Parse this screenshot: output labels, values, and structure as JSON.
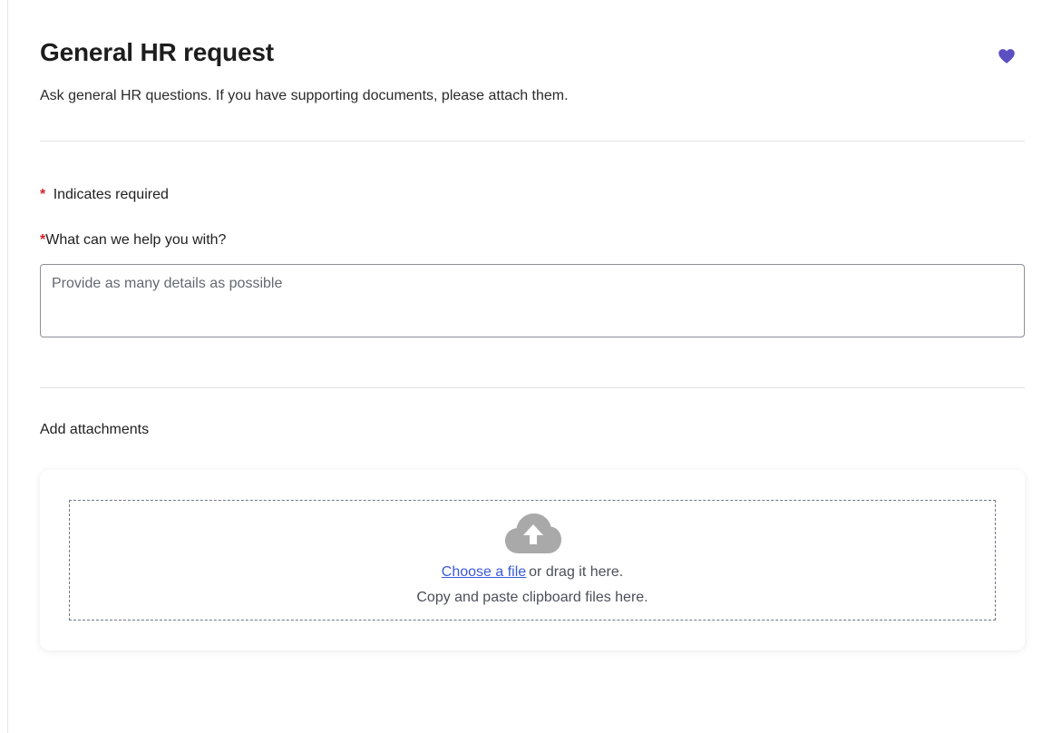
{
  "header": {
    "title": "General HR request",
    "description": "Ask general HR questions. If you have supporting documents, please attach them."
  },
  "form": {
    "required_marker": "*",
    "required_note": "Indicates required",
    "question_label": "What can we help you with?",
    "question_value": "",
    "question_placeholder": "Provide as many details as possible"
  },
  "attachments": {
    "label": "Add attachments",
    "choose_link": "Choose a file",
    "drag_text": "or drag it here.",
    "paste_text": "Copy and paste clipboard files here."
  },
  "icons": {
    "favorite": "heart-icon",
    "upload": "cloud-upload-icon"
  },
  "colors": {
    "accent": "#5b4fc2",
    "required": "#d1242f",
    "link": "#3a5bd9",
    "upload_icon": "#a9a9a9"
  }
}
